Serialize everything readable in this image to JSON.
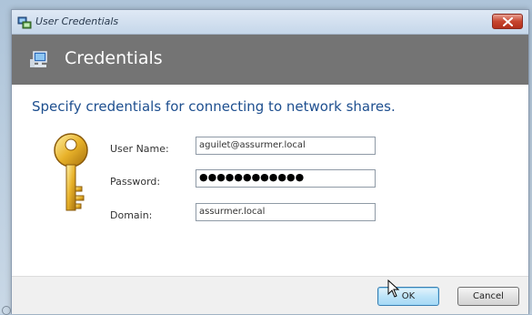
{
  "window": {
    "title": "User Credentials"
  },
  "header": {
    "title": "Credentials",
    "icon": "network-computer-icon"
  },
  "main": {
    "prompt": "Specify credentials for connecting to network shares.",
    "fields": {
      "username": {
        "label": "User Name:",
        "value": "aguilet@assurmer.local"
      },
      "password": {
        "label": "Password:",
        "value": "●●●●●●●●●●●●"
      },
      "domain": {
        "label": "Domain:",
        "value": "assurmer.local"
      }
    }
  },
  "footer": {
    "ok_label": "OK",
    "cancel_label": "Cancel"
  },
  "colors": {
    "header_band": "#747474",
    "prompt_text": "#1e4f8f",
    "close_button": "#c7452f",
    "ok_button": "#bde4f9"
  }
}
